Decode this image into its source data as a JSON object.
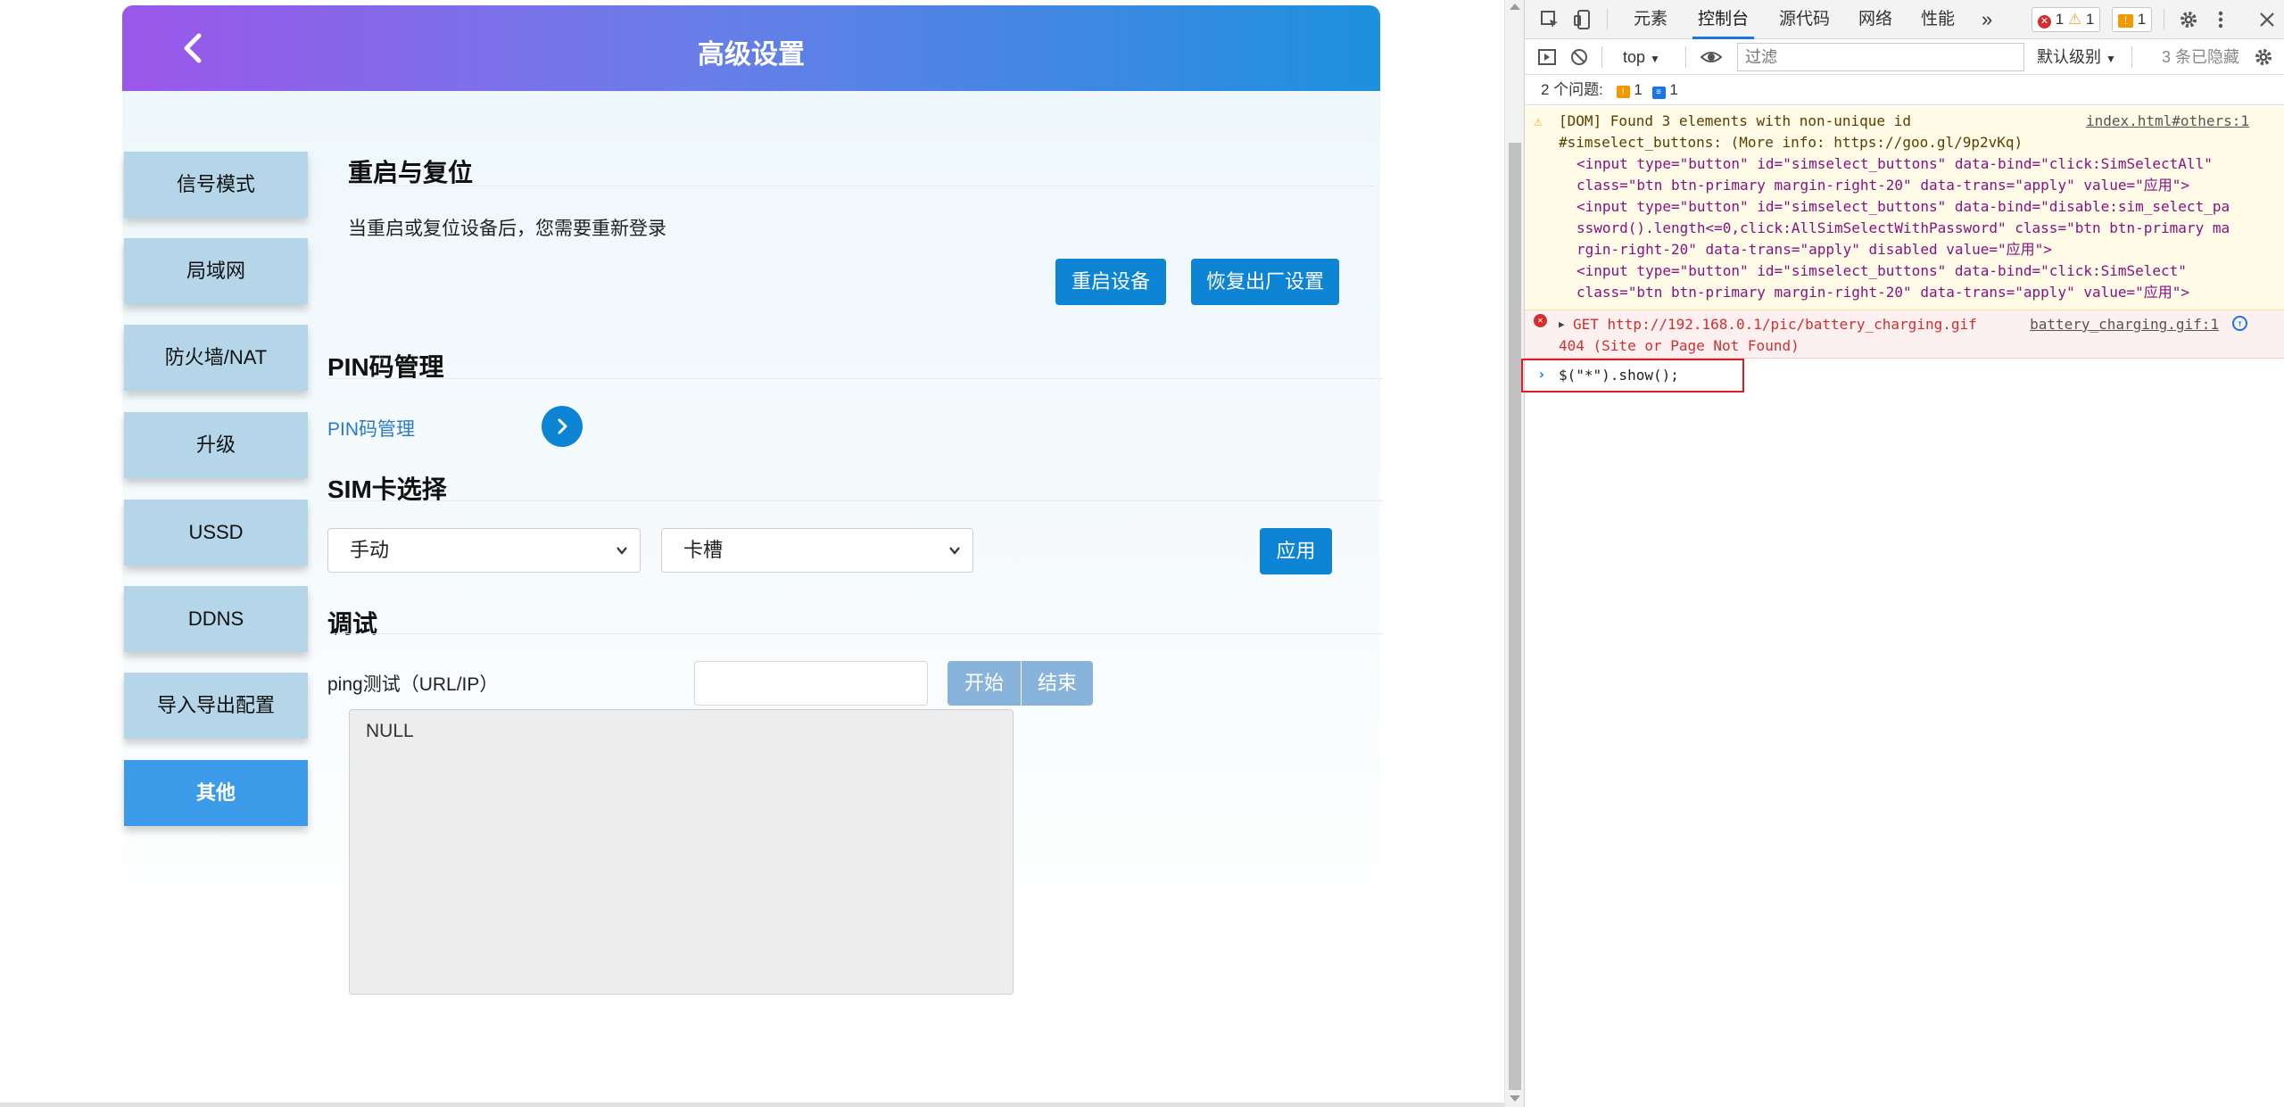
{
  "page": {
    "title": "高级设置",
    "sidebar": [
      {
        "label": "信号模式"
      },
      {
        "label": "局域网"
      },
      {
        "label": "防火墙/NAT"
      },
      {
        "label": "升级"
      },
      {
        "label": "USSD"
      },
      {
        "label": "DDNS"
      },
      {
        "label": "导入导出配置"
      },
      {
        "label": "其他",
        "active": true
      }
    ],
    "reboot": {
      "title": "重启与复位",
      "note": "当重启或复位设备后，您需要重新登录",
      "reboot_label": "重启设备",
      "factory_label": "恢复出厂设置"
    },
    "pin": {
      "title": "PIN码管理",
      "link_label": "PIN码管理"
    },
    "sim": {
      "title": "SIM卡选择",
      "mode_value": "手动",
      "slot_value": "卡槽",
      "apply_label": "应用"
    },
    "debug": {
      "title": "调试",
      "ping_label": "ping测试（URL/IP）",
      "ping_value": "",
      "start_label": "开始",
      "stop_label": "结束",
      "output": "NULL"
    }
  },
  "devtools": {
    "tabs": [
      "元素",
      "控制台",
      "源代码",
      "网络",
      "性能"
    ],
    "active_tab": "控制台",
    "more": "»",
    "badges": {
      "errors": "1",
      "warnings": "1",
      "issues": "1"
    },
    "toolbar": {
      "context": "top",
      "filter_placeholder": "过滤",
      "levels": "默认级别",
      "hidden": "3 条已隐藏"
    },
    "issues_bar": {
      "label": "2 个问题:",
      "warn_count": "1",
      "info_count": "1"
    },
    "warning": {
      "lines": [
        "[DOM] Found 3 elements with non-unique id",
        "#simselect_buttons: (More info: https://goo.gl/9p2vKq)",
        "<input type=\"button\" id=\"simselect_buttons\" data-bind=\"click:SimSelectAll\"",
        "class=\"btn btn-primary margin-right-20\" data-trans=\"apply\" value=\"应用\">",
        "<input type=\"button\" id=\"simselect_buttons\" data-bind=\"disable:sim_select_pa",
        "ssword().length<=0,click:AllSimSelectWithPassword\" class=\"btn btn-primary ma",
        "rgin-right-20\" data-trans=\"apply\" disabled value=\"应用\">",
        "<input type=\"button\" id=\"simselect_buttons\" data-bind=\"click:SimSelect\"",
        "class=\"btn btn-primary margin-right-20\" data-trans=\"apply\" value=\"应用\">"
      ],
      "source": "index.html#others:1"
    },
    "error": {
      "line1": "GET http://192.168.0.1/pic/battery_charging.gif",
      "line2": "404 (Site or Page Not Found)",
      "source": "battery_charging.gif:1"
    },
    "command": "$(\"*\").show();",
    "colors": {
      "accent": "#1a73e8",
      "error": "#d32f2f",
      "warning": "#f9a825",
      "highlight_box": "#e01b24"
    }
  }
}
